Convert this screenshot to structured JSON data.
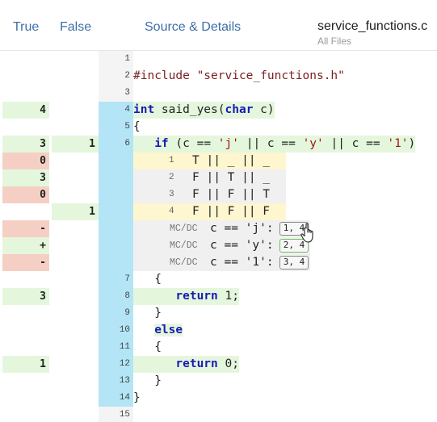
{
  "header": {
    "col_true": "True",
    "col_false": "False",
    "col_source": "Source & Details",
    "file_name": "service_functions.c",
    "file_scope": "All Files"
  },
  "lines": [
    {
      "num": "1",
      "true": "",
      "false": "",
      "code": ""
    },
    {
      "num": "2",
      "true": "",
      "false": "",
      "code": "#include \"service_functions.h\""
    },
    {
      "num": "3",
      "true": "",
      "false": "",
      "code": ""
    },
    {
      "num": "4",
      "true": "4",
      "false": "",
      "code": "int said_yes(char c)"
    },
    {
      "num": "5",
      "true": "",
      "false": "",
      "code": "{"
    },
    {
      "num": "6",
      "true": "3",
      "false": "1",
      "code": "   if (c == 'j' || c == 'y' || c == '1')"
    },
    {
      "num": "7",
      "true": "",
      "false": "",
      "code": "   {"
    },
    {
      "num": "8",
      "true": "3",
      "false": "",
      "code": "      return 1;"
    },
    {
      "num": "9",
      "true": "",
      "false": "",
      "code": "   }"
    },
    {
      "num": "10",
      "true": "",
      "false": "",
      "code": "   else"
    },
    {
      "num": "11",
      "true": "",
      "false": "",
      "code": "   {"
    },
    {
      "num": "12",
      "true": "1",
      "false": "",
      "code": "      return 0;"
    },
    {
      "num": "13",
      "true": "",
      "false": "",
      "code": "   }"
    },
    {
      "num": "14",
      "true": "",
      "false": "",
      "code": "}"
    },
    {
      "num": "15",
      "true": "",
      "false": "",
      "code": ""
    }
  ],
  "truth_table": [
    {
      "num": "1",
      "true": "0",
      "false": "",
      "value": "T || _ || _"
    },
    {
      "num": "2",
      "true": "3",
      "false": "",
      "value": "F || T || _"
    },
    {
      "num": "3",
      "true": "0",
      "false": "",
      "value": "F || F || T"
    },
    {
      "num": "4",
      "true": "",
      "false": "1",
      "value": "F || F || F"
    }
  ],
  "mcdc": [
    {
      "label": "MC/DC",
      "status": "-",
      "expr": "c == 'j':",
      "pair": "1, 4"
    },
    {
      "label": "MC/DC",
      "status": "+",
      "expr": "c == 'y':",
      "pair": "2, 4"
    },
    {
      "label": "MC/DC",
      "status": "-",
      "expr": "c == '1':",
      "pair": "3, 4"
    }
  ],
  "colors": {
    "coverage_gutter": "#b3e5f6",
    "count_green": "#e4f7dd",
    "count_red": "#f6cfc4",
    "condition_yellow": "#fdf6cf",
    "header_link": "#3f6ea8"
  }
}
